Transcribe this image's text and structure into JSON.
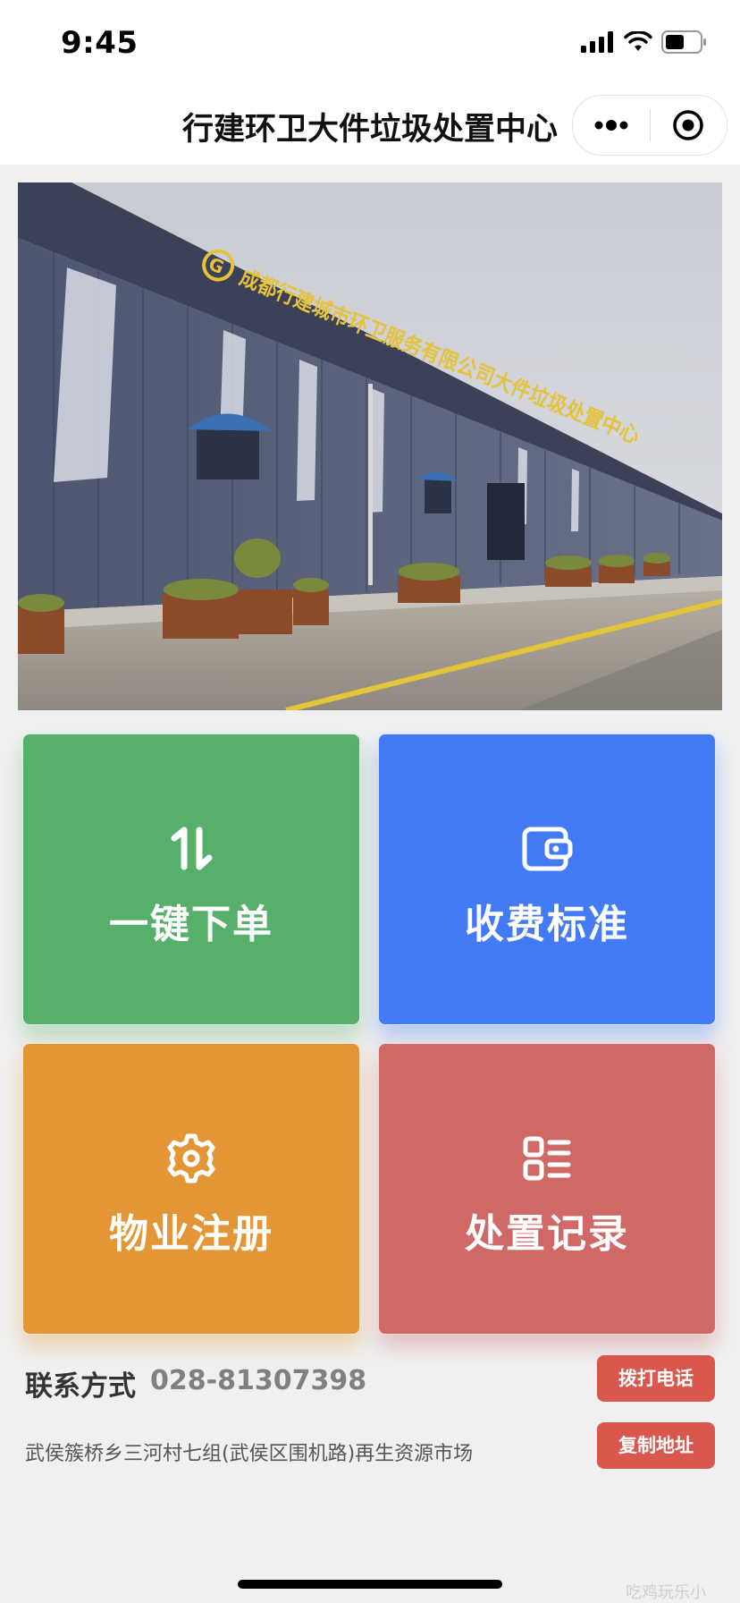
{
  "status_bar": {
    "time": "9:45"
  },
  "nav": {
    "title": "行建环卫大件垃圾处置中心"
  },
  "banner": {
    "sign_text": "成都行建城市环卫服务有限公司大件垃圾处置中心",
    "logo_letter": "G"
  },
  "tiles": [
    {
      "label": "一键下单",
      "icon": "sort-arrows-icon",
      "color": "#56b06a"
    },
    {
      "label": "收费标准",
      "icon": "wallet-icon",
      "color": "#437af5"
    },
    {
      "label": "物业注册",
      "icon": "gear-icon",
      "color": "#e49636"
    },
    {
      "label": "处置记录",
      "icon": "list-icon",
      "color": "#d06866"
    }
  ],
  "contact": {
    "label": "联系方式",
    "phone": "028-81307398",
    "call_button": "拨打电话",
    "copy_button": "复制地址",
    "address": "武侯簇桥乡三河村七组(武侯区围机路)再生资源市场"
  },
  "watermark": "吃鸡玩乐小"
}
